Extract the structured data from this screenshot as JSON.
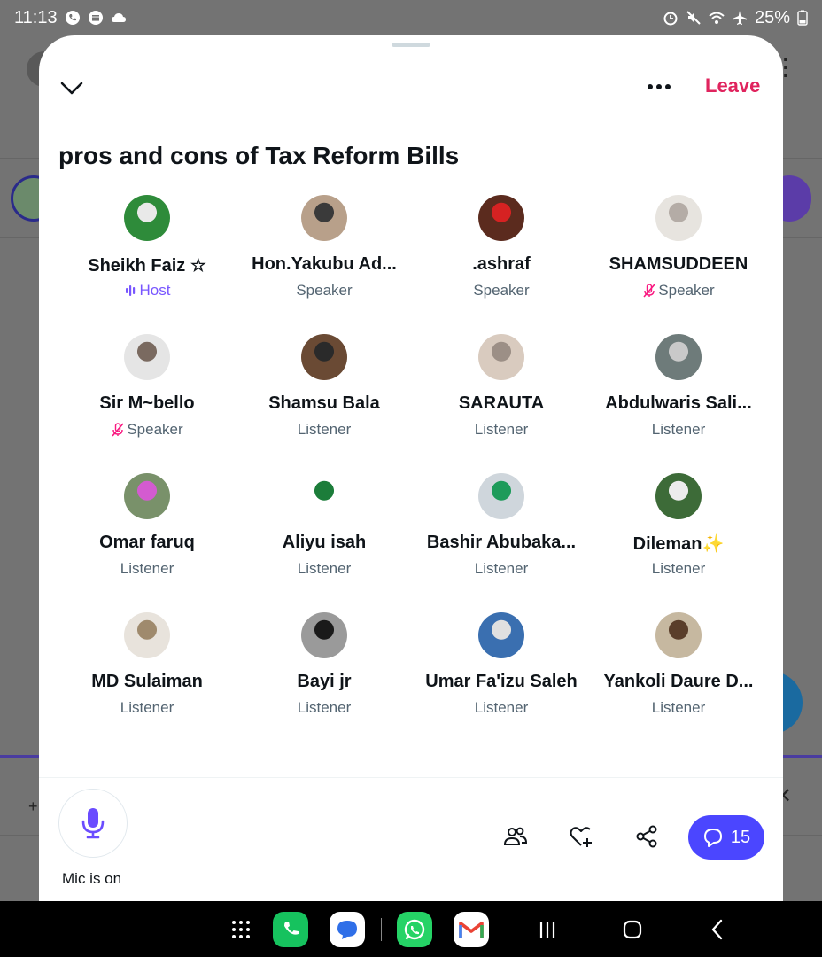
{
  "status_bar": {
    "time": "11:13",
    "battery": "25%"
  },
  "sheet": {
    "leave_label": "Leave",
    "title": "pros and cons of Tax Reform Bills"
  },
  "participants": [
    {
      "name": "Sheikh Faiz ☆",
      "role": "Host"
    },
    {
      "name": "Hon.Yakubu Ad...",
      "role": "Speaker"
    },
    {
      "name": ".ashraf",
      "role": "Speaker"
    },
    {
      "name": "SHAMSUDDEEN",
      "role": "Speaker"
    },
    {
      "name": "Sir M~bello",
      "role": "Speaker"
    },
    {
      "name": "Shamsu Bala",
      "role": "Listener"
    },
    {
      "name": "SARAUTA",
      "role": "Listener"
    },
    {
      "name": "Abdulwaris Sali...",
      "role": "Listener"
    },
    {
      "name": "Omar faruq",
      "role": "Listener"
    },
    {
      "name": "Aliyu isah",
      "role": "Listener"
    },
    {
      "name": "Bashir Abubaka...",
      "role": "Listener"
    },
    {
      "name": "Dileman✨",
      "role": "Listener"
    },
    {
      "name": "MD Sulaiman",
      "role": "Listener"
    },
    {
      "name": "Bayi jr",
      "role": "Listener"
    },
    {
      "name": "Umar Fa'izu Saleh",
      "role": "Listener"
    },
    {
      "name": "Yankoli Daure D...",
      "role": "Listener"
    }
  ],
  "footer": {
    "mic_label": "Mic is on",
    "comment_count": "15"
  },
  "colors": {
    "accent": "#4b46ff",
    "leave": "#e0245e",
    "host": "#7856ff"
  }
}
